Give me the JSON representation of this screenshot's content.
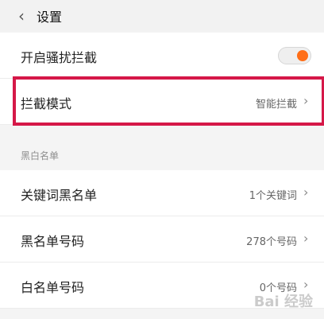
{
  "header": {
    "title": "设置"
  },
  "rows": {
    "harassment": {
      "label": "开启骚扰拦截",
      "toggle_state": "on",
      "toggle_color": "#ff6e17"
    },
    "mode": {
      "label": "拦截模式",
      "value": "智能拦截"
    },
    "keyword": {
      "label": "关键词黑名单",
      "value": "1个关键词"
    },
    "blacklist": {
      "label": "黑名单号码",
      "value": "278个号码"
    },
    "whitelist": {
      "label": "白名单号码",
      "value": "0个号码"
    }
  },
  "section": {
    "label": "黑白名单"
  },
  "watermark": {
    "text": "Bai 经验"
  },
  "colors": {
    "highlight": "#d51848"
  }
}
